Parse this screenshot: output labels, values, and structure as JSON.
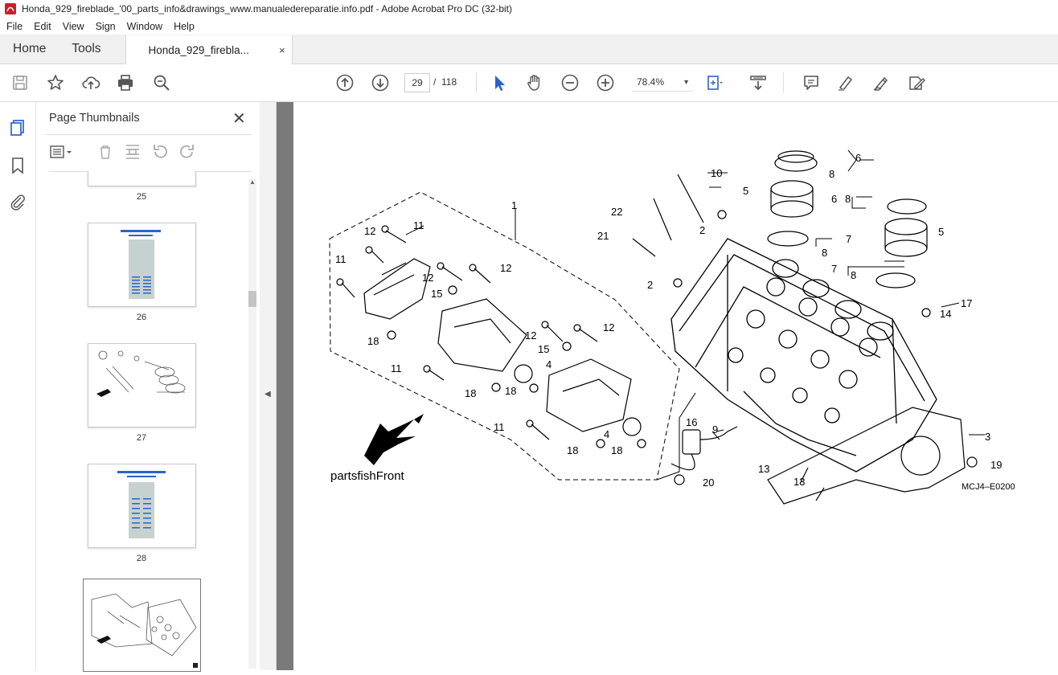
{
  "window": {
    "title": "Honda_929_fireblade_'00_parts_info&drawings_www.manualedereparatie.info.pdf - Adobe Acrobat Pro DC (32-bit)"
  },
  "menu": [
    "File",
    "Edit",
    "View",
    "Sign",
    "Window",
    "Help"
  ],
  "tabs": {
    "home": "Home",
    "tools": "Tools",
    "document": "Honda_929_firebla...",
    "close": "×"
  },
  "toolbar": {
    "current_page": "29",
    "separator": "/",
    "total_pages": "118",
    "zoom": "78.4%"
  },
  "sidebar": {
    "title": "Page Thumbnails",
    "close": "✕",
    "thumbnails": [
      {
        "label": "25"
      },
      {
        "label": "26"
      },
      {
        "label": "27"
      },
      {
        "label": "28"
      },
      {
        "label": ""
      }
    ]
  },
  "diagram": {
    "callouts": [
      "1",
      "2",
      "2",
      "2",
      "3",
      "4",
      "4",
      "5",
      "5",
      "6",
      "6",
      "7",
      "7",
      "8",
      "8",
      "8",
      "8",
      "9",
      "10",
      "11",
      "11",
      "11",
      "11",
      "12",
      "12",
      "12",
      "12",
      "12",
      "12",
      "13",
      "13",
      "14",
      "15",
      "15",
      "16",
      "17",
      "18",
      "18",
      "18",
      "18",
      "18",
      "19",
      "20",
      "21",
      "22"
    ],
    "watermark": "partsfishFront",
    "code": "MCJ4–E0200"
  },
  "colors": {
    "viewer_bg": "#7a7a7a",
    "accent_blue": "#2a64c8",
    "title_red": "#c7202a"
  }
}
